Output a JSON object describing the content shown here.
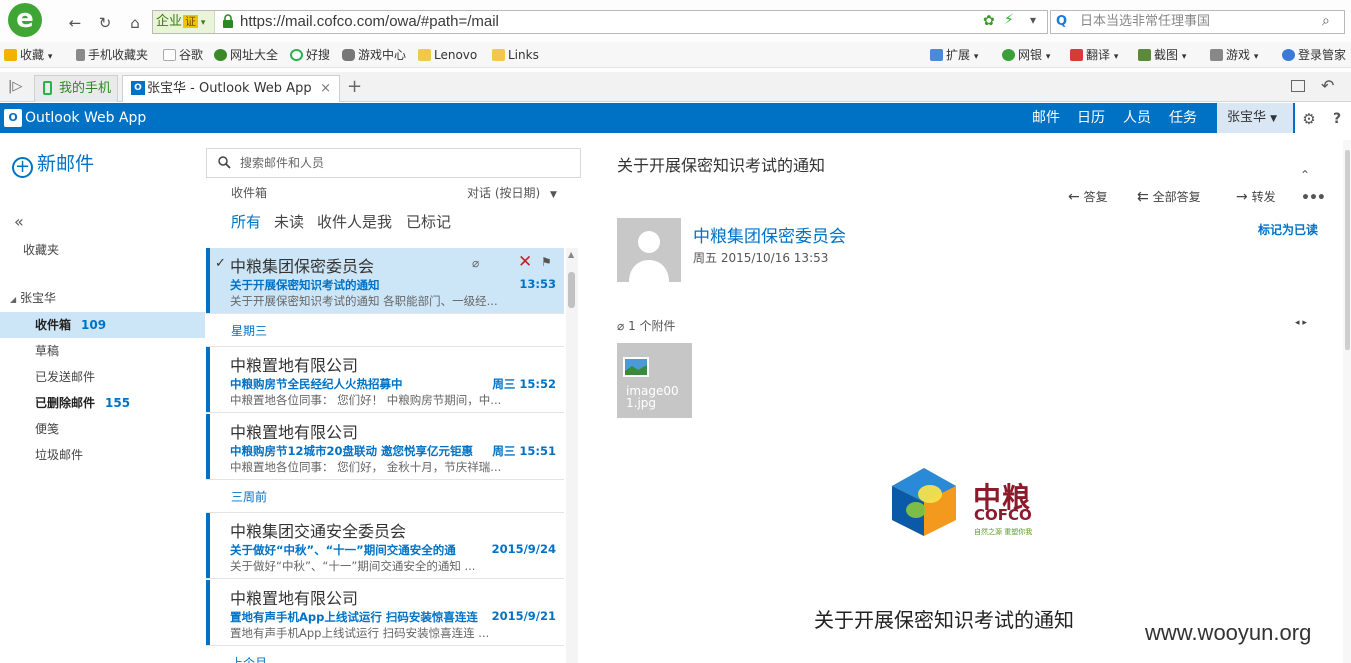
{
  "browser": {
    "url": "https://mail.cofco.com/owa/#path=/mail",
    "enterprise_label": "企业",
    "enterprise_badge": "证",
    "search_placeholder": "日本当选非常任理事国",
    "bookmarks": [
      "收藏",
      "手机收藏夹",
      "谷歌",
      "网址大全",
      "好搜",
      "游戏中心",
      "Lenovo",
      "Links"
    ],
    "right_tools": [
      "扩展",
      "网银",
      "翻译",
      "截图",
      "游戏",
      "登录管家"
    ],
    "tabs": [
      "我的手机",
      "张宝华 - Outlook Web App"
    ],
    "new_tab": "+"
  },
  "owa": {
    "app_title": "Outlook Web App",
    "nav": [
      "邮件",
      "日历",
      "人员",
      "任务"
    ],
    "user": "张宝华",
    "gear": "⚙",
    "help": "?"
  },
  "left": {
    "new_mail": "新邮件",
    "collapse": "«",
    "favorites": "收藏夹",
    "account": "张宝华",
    "folders": [
      {
        "name": "收件箱",
        "count": "109"
      },
      {
        "name": "草稿",
        "count": ""
      },
      {
        "name": "已发送邮件",
        "count": ""
      },
      {
        "name": "已删除邮件",
        "count": "155"
      },
      {
        "name": "便笺",
        "count": ""
      },
      {
        "name": "垃圾邮件",
        "count": ""
      }
    ]
  },
  "list": {
    "search_placeholder": "搜索邮件和人员",
    "folder_label": "收件箱",
    "sort_label": "对话 (按日期)",
    "filters": [
      "所有",
      "未读",
      "收件人是我",
      "已标记"
    ],
    "groups": [
      "星期三",
      "三周前",
      "上个月"
    ],
    "items": [
      {
        "sender": "中粮集团保密委员会",
        "subject": "关于开展保密知识考试的通知",
        "time": "13:53",
        "preview": "关于开展保密知识考试的通知  各职能部门、一级经..."
      },
      {
        "sender": "中粮置地有限公司",
        "subject": "中粮购房节全民经纪人火热招募中",
        "time": "周三 15:52",
        "preview": "中粮置地各位同事：  您们好！ 中粮购房节期间，中..."
      },
      {
        "sender": "中粮置地有限公司",
        "subject": "中粮购房节12城市20盘联动 邀您悦享亿元钜惠",
        "time": "周三 15:51",
        "preview": "中粮置地各位同事：  您们好，  金秋十月，节庆祥瑞..."
      },
      {
        "sender": "中粮集团交通安全委员会",
        "subject": "关于做好“中秋”、“十一”期间交通安全的通",
        "time": "2015/9/24",
        "preview": "关于做好“中秋”、“十一”期间交通安全的通知   ..."
      },
      {
        "sender": "中粮置地有限公司",
        "subject": "置地有声手机App上线试运行 扫码安装惊喜连连",
        "time": "2015/9/21",
        "preview": "置地有声手机App上线试运行 扫码安装惊喜连连   ..."
      }
    ]
  },
  "reading": {
    "title": "关于开展保密知识考试的通知",
    "reply": "答复",
    "reply_all": "全部答复",
    "forward": "转发",
    "from": "中粮集团保密委员会",
    "date": "周五 2015/10/16 13:53",
    "mark_read": "标记为已读",
    "attachment_count": "1 个附件",
    "attachment_name": "image001.jpg",
    "logo_cn": "中粮",
    "logo_en": "COFCO",
    "logo_slogan": "自然之源 重塑你我",
    "body_title": "关于开展保密知识考试的通知"
  },
  "watermark": "www.wooyun.org"
}
